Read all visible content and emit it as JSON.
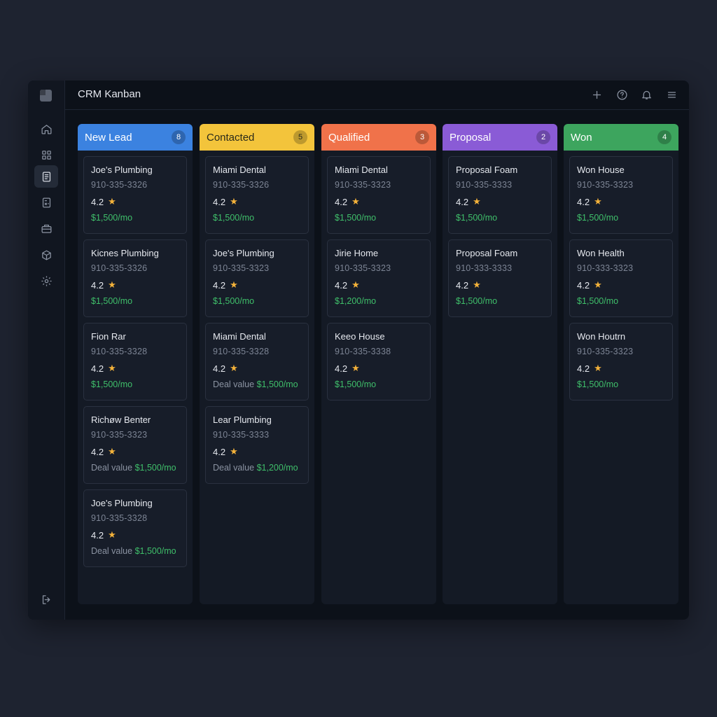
{
  "app": {
    "title": "CRM Kanban"
  },
  "colors": {
    "new_lead": "#3b82e0",
    "contacted": "#f3c43b",
    "qualified": "#f0724a",
    "proposal": "#8a5bd6",
    "won": "#3da55e",
    "deal_green": "#3fbf6a",
    "star": "#f4b23a"
  },
  "sidebar": {
    "items": [
      {
        "icon": "home-icon"
      },
      {
        "icon": "grid-icon"
      },
      {
        "icon": "document-icon",
        "active": true
      },
      {
        "icon": "calculator-icon"
      },
      {
        "icon": "briefcase-icon"
      },
      {
        "icon": "box-icon"
      },
      {
        "icon": "gear-icon"
      }
    ],
    "logout_icon": "logout-icon"
  },
  "toolbar": {
    "icons": [
      "plus-icon",
      "help-icon",
      "bell-icon",
      "menu-icon"
    ]
  },
  "columns": [
    {
      "title": "New Lead",
      "count": "8",
      "color": "#3b82e0",
      "cards": [
        {
          "name": "Joe's Plumbing",
          "phone": "910-335-3326",
          "rating": "4.2",
          "deal_label": "",
          "value": "$1,500/mo"
        },
        {
          "name": "Kicnes Plumbing",
          "phone": "910-335-3326",
          "rating": "4.2",
          "deal_label": "",
          "value": "$1,500/mo"
        },
        {
          "name": "Fion Rar",
          "phone": "910-335-3328",
          "rating": "4.2",
          "deal_label": "",
          "value": "$1,500/mo"
        },
        {
          "name": "Richøw Benter",
          "phone": "910-335-3323",
          "rating": "4.2",
          "deal_label": "Deal value",
          "value": "$1,500/mo"
        },
        {
          "name": "Joe's Plumbing",
          "phone": "910-335-3328",
          "rating": "4.2",
          "deal_label": "Deal value",
          "value": "$1,500/mo"
        }
      ]
    },
    {
      "title": "Contacted",
      "count": "5",
      "color": "#f3c43b",
      "cards": [
        {
          "name": "Miami Dental",
          "phone": "910-335-3326",
          "rating": "4.2",
          "deal_label": "",
          "value": "$1,500/mo"
        },
        {
          "name": "Joe's Plumbing",
          "phone": "910-335-3323",
          "rating": "4.2",
          "deal_label": "",
          "value": "$1,500/mo"
        },
        {
          "name": "Miami Dental",
          "phone": "910-335-3328",
          "rating": "4.2",
          "deal_label": "Deal value",
          "value": "$1,500/mo"
        },
        {
          "name": "Lear Plumbing",
          "phone": "910-335-3333",
          "rating": "4.2",
          "deal_label": "Deal value",
          "value": "$1,200/mo"
        }
      ]
    },
    {
      "title": "Qualified",
      "count": "3",
      "color": "#f0724a",
      "cards": [
        {
          "name": "Miami Dental",
          "phone": "910-335-3323",
          "rating": "4.2",
          "deal_label": "",
          "value": "$1,500/mo"
        },
        {
          "name": "Jirie Home",
          "phone": "910-335-3323",
          "rating": "4.2",
          "deal_label": "",
          "value": "$1,200/mo"
        },
        {
          "name": "Keeo House",
          "phone": "910-335-3338",
          "rating": "4.2",
          "deal_label": "",
          "value": "$1,500/mo"
        }
      ]
    },
    {
      "title": "Proposal",
      "count": "2",
      "color": "#8a5bd6",
      "cards": [
        {
          "name": "Proposal Foam",
          "phone": "910-335-3333",
          "rating": "4.2",
          "deal_label": "",
          "value": "$1,500/mo"
        },
        {
          "name": "Proposal Foam",
          "phone": "910-333-3333",
          "rating": "4.2",
          "deal_label": "",
          "value": "$1,500/mo"
        }
      ]
    },
    {
      "title": "Won",
      "count": "4",
      "color": "#3da55e",
      "cards": [
        {
          "name": "Won House",
          "phone": "910-335-3323",
          "rating": "4.2",
          "deal_label": "",
          "value": "$1,500/mo"
        },
        {
          "name": "Won Health",
          "phone": "910-333-3323",
          "rating": "4.2",
          "deal_label": "",
          "value": "$1,500/mo"
        },
        {
          "name": "Won Houtrn",
          "phone": "910-335-3323",
          "rating": "4.2",
          "deal_label": "",
          "value": "$1,500/mo"
        }
      ]
    }
  ]
}
